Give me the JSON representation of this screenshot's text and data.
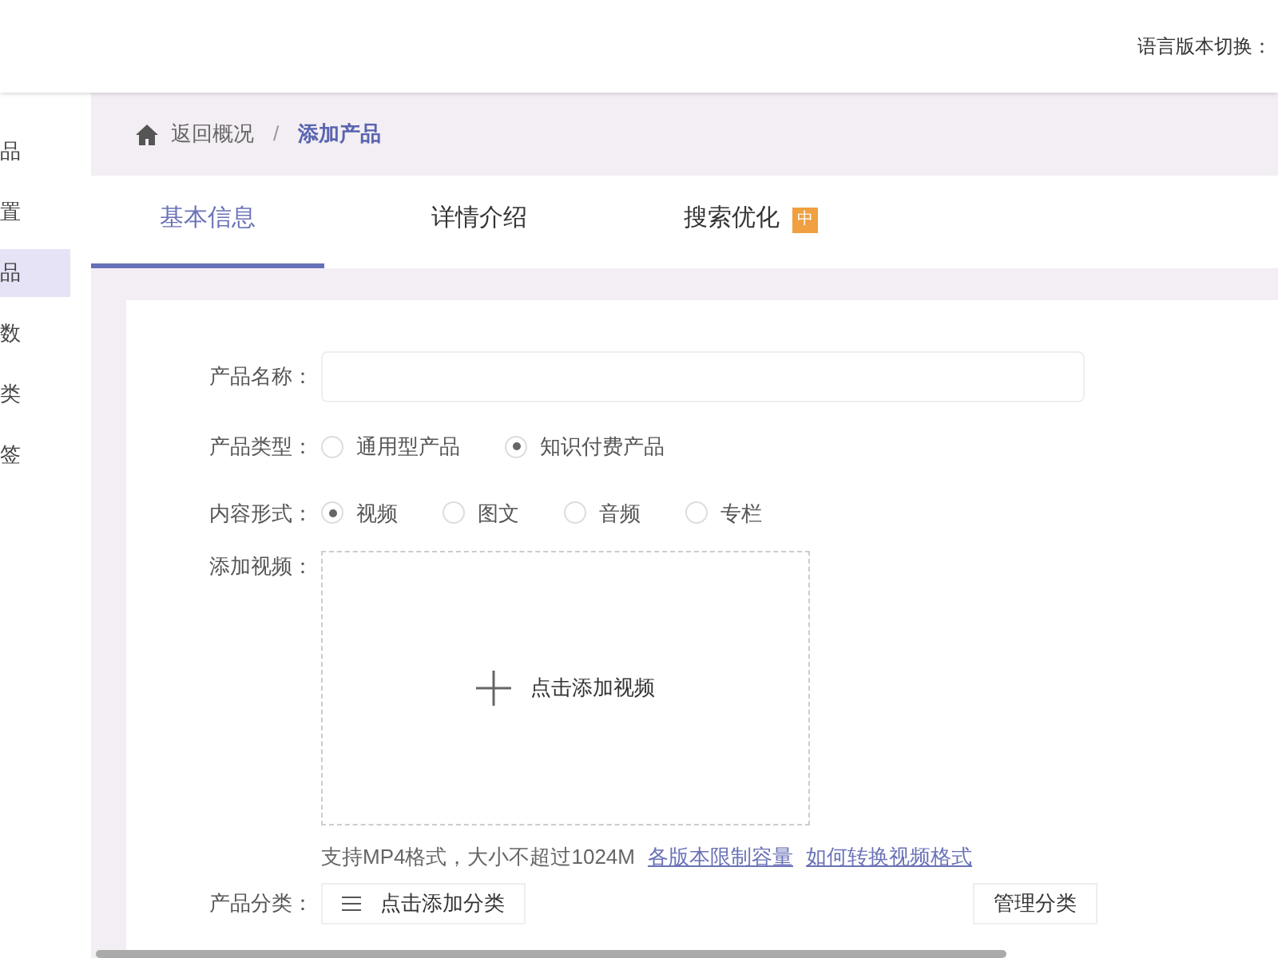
{
  "header": {
    "language_label": "语言版本切换："
  },
  "sidebar": {
    "items": [
      {
        "label": "品",
        "selected": false
      },
      {
        "label": "置",
        "selected": false
      },
      {
        "label": "品",
        "selected": true
      },
      {
        "label": "数",
        "selected": false
      },
      {
        "label": "类",
        "selected": false
      },
      {
        "label": "签",
        "selected": false
      }
    ]
  },
  "breadcrumb": {
    "back": "返回概况",
    "separator": "/",
    "current": "添加产品"
  },
  "tabs": [
    {
      "label": "基本信息",
      "selected": true
    },
    {
      "label": "详情介绍",
      "selected": false
    },
    {
      "label": "搜索优化",
      "selected": false,
      "badge": "中"
    }
  ],
  "form": {
    "name_label": "产品名称：",
    "type_label": "产品类型：",
    "type_options": [
      {
        "label": "通用型产品",
        "selected": false
      },
      {
        "label": "知识付费产品",
        "selected": true
      }
    ],
    "content_label": "内容形式：",
    "content_options": [
      {
        "label": "视频",
        "selected": true
      },
      {
        "label": "图文",
        "selected": false
      },
      {
        "label": "音频",
        "selected": false
      },
      {
        "label": "专栏",
        "selected": false
      }
    ],
    "video_label": "添加视频：",
    "upload_text": "点击添加视频",
    "hint": "支持MP4格式，大小不超过1024M",
    "links": [
      "各版本限制容量",
      "如何转换视频格式"
    ],
    "category_label": "产品分类：",
    "add_category": "点击添加分类",
    "manage_category": "管理分类"
  }
}
